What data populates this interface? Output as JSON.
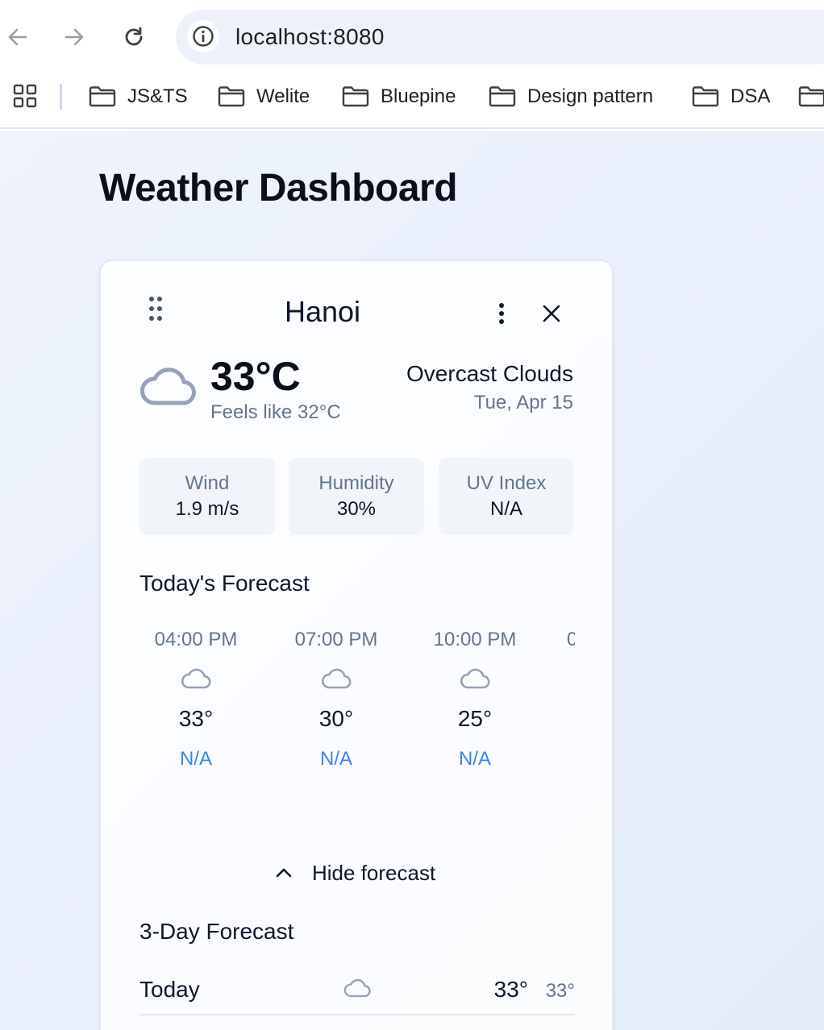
{
  "browser": {
    "url": "localhost:8080",
    "bookmarks": [
      {
        "label": "JS&TS"
      },
      {
        "label": "Welite"
      },
      {
        "label": "Bluepine"
      },
      {
        "label": "Design pattern"
      },
      {
        "label": "DSA"
      }
    ]
  },
  "page": {
    "title": "Weather Dashboard"
  },
  "card": {
    "city": "Hanoi",
    "current": {
      "temperature": "33°C",
      "feels_like": "Feels like 32°C",
      "condition": "Overcast Clouds",
      "date": "Tue, Apr 15",
      "icon": "cloud-icon"
    },
    "stats": [
      {
        "label": "Wind",
        "value": "1.9 m/s"
      },
      {
        "label": "Humidity",
        "value": "30%"
      },
      {
        "label": "UV Index",
        "value": "N/A"
      }
    ],
    "todays_forecast": {
      "title": "Today's Forecast",
      "hours": [
        {
          "time": "04:00 PM",
          "temp": "33°",
          "extra": "N/A",
          "icon": "cloud-icon"
        },
        {
          "time": "07:00 PM",
          "temp": "30°",
          "extra": "N/A",
          "icon": "cloud-icon"
        },
        {
          "time": "10:00 PM",
          "temp": "25°",
          "extra": "N/A",
          "icon": "cloud-icon"
        },
        {
          "time": "0",
          "temp": "",
          "extra": "",
          "icon": ""
        }
      ]
    },
    "toggle_label": "Hide forecast",
    "three_day": {
      "title": "3-Day Forecast",
      "days": [
        {
          "name": "Today",
          "high": "33°",
          "low": "33°",
          "icon": "cloud-icon"
        }
      ]
    }
  },
  "colors": {
    "accent_blue": "#3b82f6",
    "muted_text": "#64748b",
    "stat_bg": "#f1f5f9",
    "page_bg": "#eef3fc"
  }
}
